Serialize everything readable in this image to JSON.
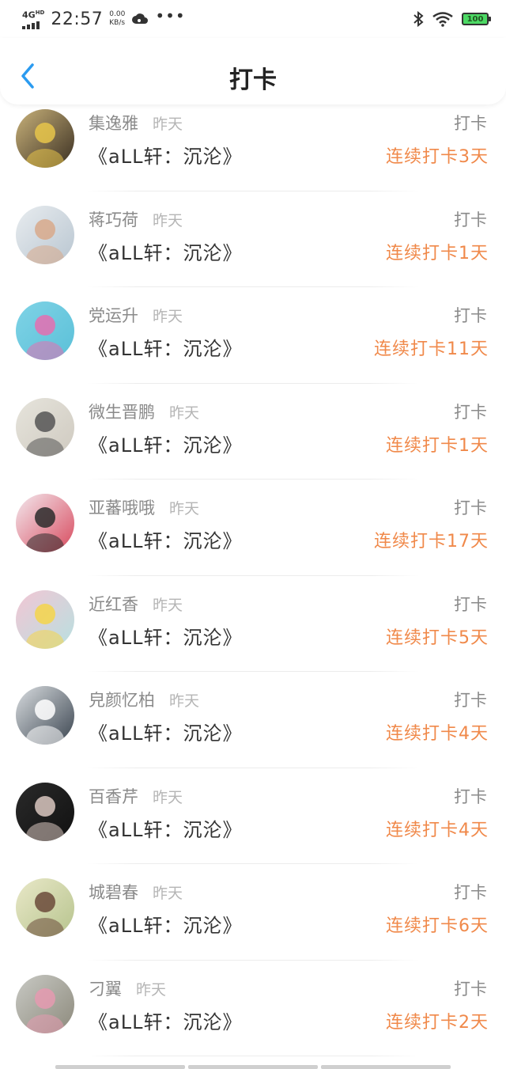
{
  "status_bar": {
    "network": "4G",
    "network_sup": "HD",
    "time": "22:57",
    "speed_value": "0.00",
    "speed_unit": "KB/s",
    "more": "•••",
    "battery": "100"
  },
  "header": {
    "title": "打卡"
  },
  "checkins": [
    {
      "name": "集逸雅",
      "time": "昨天",
      "book": "《aLL轩：沉沦》",
      "action": "打卡",
      "streak": "连续打卡3天",
      "avatar": {
        "bg1": "#c9b27a",
        "bg2": "#3a2f22",
        "accent": "#e8c54a"
      }
    },
    {
      "name": "蒋巧荷",
      "time": "昨天",
      "book": "《aLL轩：沉沦》",
      "action": "打卡",
      "streak": "连续打卡1天",
      "avatar": {
        "bg1": "#e8ecef",
        "bg2": "#b9c6d1",
        "accent": "#d8a98b"
      }
    },
    {
      "name": "党运升",
      "time": "昨天",
      "book": "《aLL轩：沉沦》",
      "action": "打卡",
      "streak": "连续打卡11天",
      "avatar": {
        "bg1": "#7fd3e6",
        "bg2": "#5bc0d8",
        "accent": "#e56fb0"
      }
    },
    {
      "name": "微生晋鹏",
      "time": "昨天",
      "book": "《aLL轩：沉沦》",
      "action": "打卡",
      "streak": "连续打卡1天",
      "avatar": {
        "bg1": "#e6e4dc",
        "bg2": "#cfcac0",
        "accent": "#555555"
      }
    },
    {
      "name": "亚蕃哦哦",
      "time": "昨天",
      "book": "《aLL轩：沉沦》",
      "action": "打卡",
      "streak": "连续打卡17天",
      "avatar": {
        "bg1": "#f3e9ee",
        "bg2": "#d84a5e",
        "accent": "#2b2b2b"
      }
    },
    {
      "name": "近红香",
      "time": "昨天",
      "book": "《aLL轩：沉沦》",
      "action": "打卡",
      "streak": "连续打卡5天",
      "avatar": {
        "bg1": "#f2c6d4",
        "bg2": "#b8e0e0",
        "accent": "#f5d54a"
      }
    },
    {
      "name": "皃颜忆柏",
      "time": "昨天",
      "book": "《aLL轩：沉沦》",
      "action": "打卡",
      "streak": "连续打卡4天",
      "avatar": {
        "bg1": "#d9dde0",
        "bg2": "#3b4550",
        "accent": "#ffffff"
      }
    },
    {
      "name": "百香芹",
      "time": "昨天",
      "book": "《aLL轩：沉沦》",
      "action": "打卡",
      "streak": "连续打卡4天",
      "avatar": {
        "bg1": "#2a2a2a",
        "bg2": "#111111",
        "accent": "#d9c7c0"
      }
    },
    {
      "name": "城碧春",
      "time": "昨天",
      "book": "《aLL轩：沉沦》",
      "action": "打卡",
      "streak": "连续打卡6天",
      "avatar": {
        "bg1": "#e9e8c8",
        "bg2": "#b7c48e",
        "accent": "#6b4a3a"
      }
    },
    {
      "name": "刁翼",
      "time": "昨天",
      "book": "《aLL轩：沉沦》",
      "action": "打卡",
      "streak": "连续打卡2天",
      "avatar": {
        "bg1": "#c8c9c4",
        "bg2": "#8d8a7c",
        "accent": "#e59ab0"
      }
    }
  ]
}
